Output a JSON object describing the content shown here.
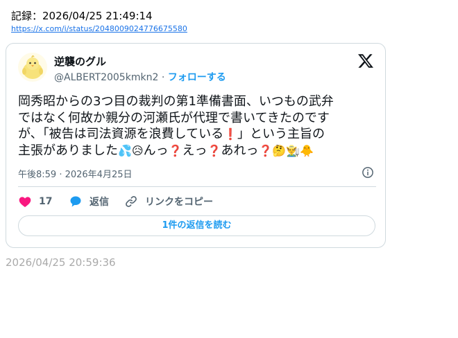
{
  "record_line": "記録：2026/04/25 21:49:14",
  "source_url": "https://x.com/i/status/2048009024776675580",
  "tweet": {
    "author_name": "逆襲のグル",
    "handle": "@ALBERT2005kmkn2",
    "separator": "·",
    "follow_label": "フォローする",
    "text_line1": "岡秀昭からの3つ目の裁判の第1準備書面、いつもの武弁",
    "text_line2": "ではなく何故か親分の河瀬氏が代理で書いてきたのです",
    "text_line3a": "が、「被告は司法資源を浪費している",
    "text_line3b": "」という主旨の",
    "text_line4a": "主張がありました",
    "text_line4b": "んっ",
    "text_line4c": "えっ",
    "text_line4d": "あれっ",
    "emoji": {
      "exclamation": "❗",
      "sweat_droplets": "💦",
      "worried_face": "😥",
      "question": "❓",
      "thinking_face": "🤔",
      "farmer": "👨‍🌾",
      "chick": "🐥"
    },
    "timestamp": "午後8:59 · 2026年4月25日",
    "like_count": "17",
    "reply_label": "返信",
    "copy_link_label": "リンクをコピー",
    "read_replies_label": "1件の返信を読む",
    "icons": {
      "brand": "x-logo-icon",
      "info": "info-icon",
      "like": "heart-icon",
      "reply": "speech-bubble-icon",
      "copy": "link-icon"
    },
    "colors": {
      "link_blue": "#1d9bf0",
      "like_pink": "#f91880",
      "muted_text": "#536471",
      "border": "#cfd9de"
    }
  },
  "footer_timestamp": "2026/04/25 20:59:36"
}
